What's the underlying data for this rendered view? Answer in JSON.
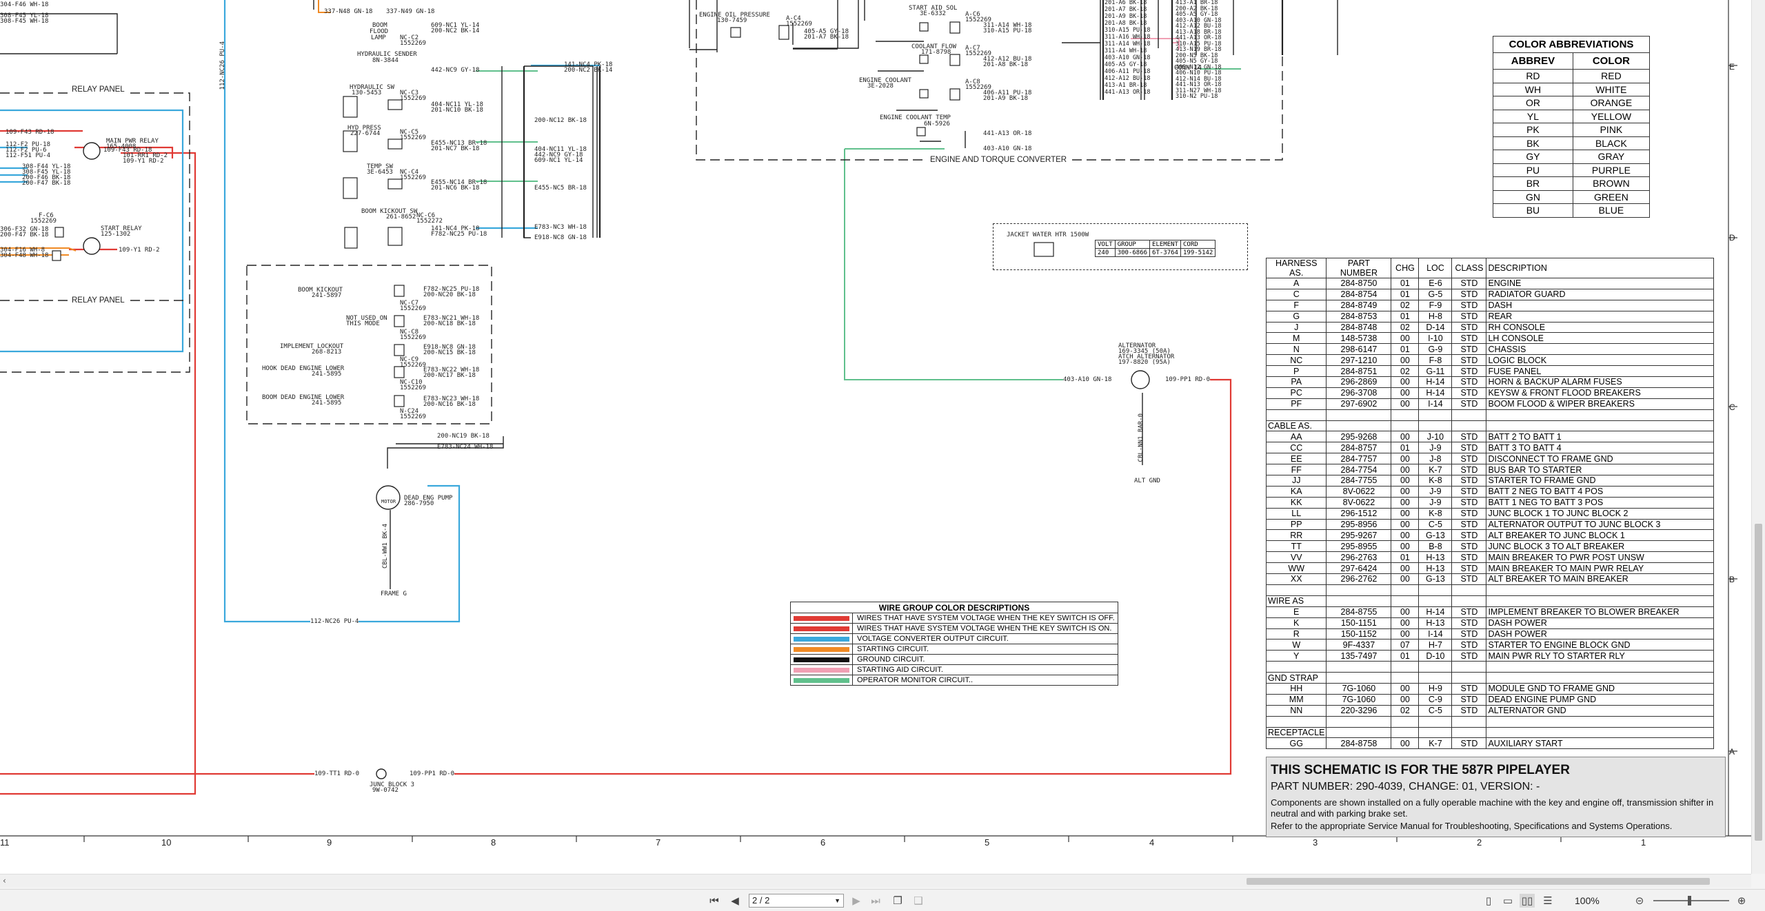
{
  "color_abbreviations": {
    "title": "COLOR ABBREVIATIONS",
    "headers": [
      "ABBREV",
      "COLOR"
    ],
    "rows": [
      [
        "RD",
        "RED"
      ],
      [
        "WH",
        "WHITE"
      ],
      [
        "OR",
        "ORANGE"
      ],
      [
        "YL",
        "YELLOW"
      ],
      [
        "PK",
        "PINK"
      ],
      [
        "BK",
        "BLACK"
      ],
      [
        "GY",
        "GRAY"
      ],
      [
        "PU",
        "PURPLE"
      ],
      [
        "BR",
        "BROWN"
      ],
      [
        "GN",
        "GREEN"
      ],
      [
        "BU",
        "BLUE"
      ]
    ]
  },
  "harness_table": {
    "headers": [
      "HARNESS AS.",
      "PART NUMBER",
      "CHG",
      "LOC",
      "CLASS",
      "DESCRIPTION"
    ],
    "sections": [
      {
        "title": "",
        "rows": [
          [
            "A",
            "284-8750",
            "01",
            "E-6",
            "STD",
            "ENGINE"
          ],
          [
            "C",
            "284-8754",
            "01",
            "G-5",
            "STD",
            "RADIATOR GUARD"
          ],
          [
            "F",
            "284-8749",
            "02",
            "F-9",
            "STD",
            "DASH"
          ],
          [
            "G",
            "284-8753",
            "01",
            "H-8",
            "STD",
            "REAR"
          ],
          [
            "J",
            "284-8748",
            "02",
            "D-14",
            "STD",
            "RH CONSOLE"
          ],
          [
            "M",
            "148-5738",
            "00",
            "I-10",
            "STD",
            "LH CONSOLE"
          ],
          [
            "N",
            "298-6147",
            "01",
            "G-9",
            "STD",
            "CHASSIS"
          ],
          [
            "NC",
            "297-1210",
            "00",
            "F-8",
            "STD",
            "LOGIC BLOCK"
          ],
          [
            "P",
            "284-8751",
            "02",
            "G-11",
            "STD",
            "FUSE PANEL"
          ],
          [
            "PA",
            "296-2869",
            "00",
            "H-14",
            "STD",
            "HORN & BACKUP ALARM FUSES"
          ],
          [
            "PC",
            "296-3708",
            "00",
            "H-14",
            "STD",
            "KEYSW & FRONT FLOOD BREAKERS"
          ],
          [
            "PF",
            "297-6902",
            "00",
            "I-14",
            "STD",
            "BOOM FLOOD & WIPER BREAKERS"
          ]
        ]
      },
      {
        "title": "CABLE AS.",
        "rows": [
          [
            "AA",
            "295-9268",
            "00",
            "J-10",
            "STD",
            "BATT 2 TO BATT 1"
          ],
          [
            "CC",
            "284-8757",
            "01",
            "J-9",
            "STD",
            "BATT 3 TO BATT 4"
          ],
          [
            "EE",
            "284-7757",
            "00",
            "J-8",
            "STD",
            "DISCONNECT TO FRAME GND"
          ],
          [
            "FF",
            "284-7754",
            "00",
            "K-7",
            "STD",
            "BUS BAR TO STARTER"
          ],
          [
            "JJ",
            "284-7755",
            "00",
            "K-8",
            "STD",
            "STARTER TO FRAME GND"
          ],
          [
            "KA",
            "8V-0622",
            "00",
            "J-9",
            "STD",
            "BATT 2 NEG TO BATT 4 POS"
          ],
          [
            "KK",
            "8V-0622",
            "00",
            "J-9",
            "STD",
            "BATT 1 NEG TO BATT 3 POS"
          ],
          [
            "LL",
            "296-1512",
            "00",
            "K-8",
            "STD",
            "JUNC BLOCK 1 TO JUNC BLOCK 2"
          ],
          [
            "PP",
            "295-8956",
            "00",
            "C-5",
            "STD",
            "ALTERNATOR OUTPUT TO JUNC BLOCK 3"
          ],
          [
            "RR",
            "295-9267",
            "00",
            "G-13",
            "STD",
            "ALT BREAKER TO JUNC BLOCK 1"
          ],
          [
            "TT",
            "295-8955",
            "00",
            "B-8",
            "STD",
            "JUNC BLOCK 3 TO ALT BREAKER"
          ],
          [
            "VV",
            "296-2763",
            "01",
            "H-13",
            "STD",
            "MAIN BREAKER TO PWR POST UNSW"
          ],
          [
            "WW",
            "297-6424",
            "00",
            "H-13",
            "STD",
            "MAIN BREAKER TO MAIN PWR RELAY"
          ],
          [
            "XX",
            "296-2762",
            "00",
            "G-13",
            "STD",
            "ALT BREAKER TO MAIN BREAKER"
          ]
        ]
      },
      {
        "title": "WIRE AS",
        "rows": [
          [
            "E",
            "284-8755",
            "00",
            "H-14",
            "STD",
            "IMPLEMENT BREAKER TO BLOWER BREAKER"
          ],
          [
            "K",
            "150-1151",
            "00",
            "H-13",
            "STD",
            "DASH POWER"
          ],
          [
            "R",
            "150-1152",
            "00",
            "I-14",
            "STD",
            "DASH POWER"
          ],
          [
            "W",
            "9F-4337",
            "07",
            "H-7",
            "STD",
            "STARTER TO ENGINE BLOCK GND"
          ],
          [
            "Y",
            "135-7497",
            "01",
            "D-10",
            "STD",
            "MAIN PWR RLY TO STARTER RLY"
          ]
        ]
      },
      {
        "title": "GND STRAP",
        "rows": [
          [
            "HH",
            "7G-1060",
            "00",
            "H-9",
            "STD",
            "MODULE GND TO FRAME GND"
          ],
          [
            "MM",
            "7G-1060",
            "00",
            "C-9",
            "STD",
            "DEAD ENGINE PUMP GND"
          ],
          [
            "NN",
            "220-3296",
            "02",
            "C-5",
            "STD",
            "ALTERNATOR GND"
          ]
        ]
      },
      {
        "title": "RECEPTACLE",
        "rows": [
          [
            "GG",
            "284-8758",
            "00",
            "K-7",
            "STD",
            "AUXILIARY START"
          ]
        ]
      }
    ]
  },
  "wire_group": {
    "title": "WIRE GROUP COLOR DESCRIPTIONS",
    "rows": [
      {
        "color": "#e03a34",
        "text": "WIRES THAT HAVE SYSTEM VOLTAGE WHEN THE KEY SWITCH IS OFF."
      },
      {
        "color": "#e03a34",
        "text": "WIRES THAT HAVE SYSTEM VOLTAGE WHEN THE KEY SWITCH IS ON."
      },
      {
        "color": "#3aa8dc",
        "text": "VOLTAGE CONVERTER OUTPUT CIRCUIT."
      },
      {
        "color": "#f08a24",
        "text": "STARTING CIRCUIT."
      },
      {
        "color": "#111111",
        "text": "GROUND CIRCUIT."
      },
      {
        "color": "#f0a0b4",
        "text": "STARTING AID CIRCUIT."
      },
      {
        "color": "#60c08c",
        "text": "OPERATOR MONITOR CIRCUIT.."
      }
    ]
  },
  "info": {
    "title": "THIS SCHEMATIC IS FOR THE 587R PIPELAYER",
    "part": "PART NUMBER: 290-4039, CHANGE: 01, VERSION: -",
    "note1": "Components are shown installed on a fully operable machine with the key and engine off, transmission shifter in neutral and with parking brake set.",
    "note2": "Refer to the appropriate Service Manual for Troubleshooting, Specifications and Systems Operations."
  },
  "jacket_water": {
    "label": "JACKET WATER HTR 1500W",
    "headers": [
      "VOLT",
      "GROUP",
      "ELEMENT",
      "CORD"
    ],
    "row": [
      "240",
      "300-6866",
      "6T-3764",
      "199-5142"
    ]
  },
  "labels": {
    "relay_panel": "RELAY PANEL",
    "relay_panel_2": "RELAY PANEL",
    "engine_torque": "ENGINE AND TORQUE CONVERTER",
    "conn14": "CONN 14",
    "main_pwr_relay": "MAIN PWR RELAY",
    "main_pwr_relay_pn": "165-4008",
    "start_relay": "START RELAY",
    "start_relay_pn": "125-1302",
    "fc6": "F-C6",
    "fc6_pn": "1552269",
    "boom_flood": "BOOM",
    "boom_flood2": "FLOOD",
    "boom_flood3": "LAMP",
    "nc_c2": "NC-C2",
    "nc_c2_pn": "1552269",
    "hyd_sender": "HYDRAULIC SENDER",
    "hyd_sender_pn": "8N-3844",
    "hyd_sw": "HYDRAULIC SW",
    "hyd_sw_pn": "130-5453",
    "nc_c3": "NC-C3",
    "nc_c3_pn": "1552269",
    "hyd_press": "HYD PRESS",
    "hyd_press_pn": "227-6744",
    "nc_c5": "NC-C5",
    "nc_c5_pn": "1552269",
    "temp_sw": "TEMP SW",
    "temp_sw_pn": "3E-6453",
    "nc_c4": "NC-C4",
    "nc_c4_pn": "1552269",
    "boom_kickout": "BOOM KICKOUT SW",
    "boom_kickout_pn": "261-8652",
    "nc_c6": "NC-C6",
    "nc_c6_pn": "1552272",
    "boom_kickout2": "BOOM KICKOUT",
    "boom_kickout2_pn": "241-5897",
    "not_used": "NOT USED ON",
    "not_used2": "THIS MODE",
    "implement_lockout": "IMPLEMENT LOCKOUT",
    "implement_lockout_pn": "268-8213",
    "hook_dead": "HOOK DEAD ENGINE LOWER",
    "hook_dead_pn": "241-5895",
    "boom_dead": "BOOM DEAD ENGINE LOWER",
    "boom_dead_pn": "241-5895",
    "nc_c7": "NC-C7",
    "nc_c8": "NC-C8",
    "nc_c9": "NC-C9",
    "nc_c10": "NC-C10",
    "n_c24": "N-C24",
    "pn_1552269": "1552269",
    "dead_eng_pump": "DEAD ENG PUMP",
    "dead_eng_pump_pn": "286-7950",
    "motor": "MOTOR",
    "frame_g": "FRAME G",
    "junc_block3": "JUNC BLOCK 3",
    "junc_block3_pn": "9W-0742",
    "engine_oil": "ENGINE OIL PRESSURE",
    "engine_oil_pn": "130-7459",
    "start_aid": "START AID SOL",
    "start_aid_pn": "3E-6332",
    "coolant_flow": "COOLANT FLOW",
    "coolant_flow_pn": "171-8798",
    "engine_coolant": "ENGINE COOLANT",
    "engine_coolant_pn": "3E-2028",
    "engine_coolant_temp": "ENGINE COOLANT TEMP",
    "engine_coolant_temp_pn": "6N-5926",
    "alternator": "ALTERNATOR",
    "alternator_pn1": "169-3345 (50A)",
    "alternator_pn2": "ATCH ALTERNATOR",
    "alternator_pn3": "197-8820 (95A)",
    "alt_gnd": "ALT GND",
    "a_c4": "A-C4",
    "a_c5": "A-C5",
    "a_c6": "A-C6",
    "a_c7": "A-C7",
    "a_c8": "A-C8",
    "pn_1552269b": "1552269"
  },
  "wire_labels": {
    "w1": "337-N48 GN-18",
    "w2": "337-N49 GN-18",
    "w3": "609-NC1 YL-14",
    "w4": "200-NC2 BK-14",
    "w5": "442-NC9 GY-18",
    "w6": "404-NC11 YL-18",
    "w7": "201-NC10 BK-18",
    "w8": "E455-NC13 BR-18",
    "w9": "201-NC7 BK-18",
    "w10": "E455-NC14 BR-18",
    "w11": "201-NC6 BK-18",
    "w12": "141-NC4 PK-18",
    "w13": "F782-NC25 PU-18",
    "w14": "F782-NC25 PU-18",
    "w15": "200-NC20 BK-18",
    "w16": "E783-NC21 WH-18",
    "w17": "200-NC18 BK-18",
    "w18": "E918-NC8 GN-18",
    "w19": "200-NC15 BK-18",
    "w20": "E783-NC22 WH-18",
    "w21": "200-NC17 BK-18",
    "w22": "E783-NC23 WH-18",
    "w23": "200-NC16 BK-18",
    "w24": "200-NC19 BK-18",
    "w25": "E783-NC24 WH-18",
    "w26": "112-NC26 PU-4",
    "w27": "109-TT1 RD-0",
    "w28": "109-PP1 RD-0",
    "w29": "403-A10 GN-18",
    "w30": "109-PP1 RD-0",
    "w31": "441-A13 OR-18",
    "w32": "403-A10 GN-18",
    "w33": "311-A14 WH-18",
    "w34": "310-A15 PU-18",
    "w35": "412-A12 BU-18",
    "w36": "201-A8 BK-18",
    "w37": "406-A11 PU-18",
    "w38": "201-A9 BK-18",
    "w39": "405-A5 GY-18",
    "w40": "201-A7 BK-18",
    "w41": "109-F43 RD-18",
    "w42": "112-F2 PU-18",
    "w43": "112-F2 PU-6",
    "w44": "112-F51 PU-4",
    "w45": "308-F44 YL-18",
    "w46": "308-F45 YL-18",
    "w47": "200-F46 BK-18",
    "w48": "200-F47 BK-18",
    "w49": "109-F43 RD-18",
    "w50": "101-RR1 RD-2",
    "w51": "109-Y1 RD-2",
    "w52": "306-F32 GN-18",
    "w53": "200-F47 BK-18",
    "w54": "304-F16 WH-8",
    "w55": "304-F48 WH-18",
    "w56": "109-Y1 RD-2",
    "w57": "304-F46 WH-18",
    "w58": "308-F45 YL-18",
    "w59": "308-F45 WH-18",
    "w60": "CBL-WW1 BK-4",
    "w61": "CBL-NN1 BAR-0",
    "w62": "141-NC4 PK-18",
    "w63": "200-NC2 BK-14",
    "w64": "E455-NC5 BR-18",
    "w65": "E783-NC3 WH-18",
    "w66": "E918-NC8 GN-18",
    "w67": "200-NC12 BK-18",
    "w68": "609-NC1 YL-14",
    "w69": "442-NC9 GY-18",
    "w70": "404-NC11 YL-18",
    "w71": "112-NC26 PU-4"
  },
  "conn14_wires": [
    "413-A1 BR-18",
    "200-A2 BK-18",
    "405-A5 GY-18",
    "403-A10 GN-18",
    "412-A12 BU-18",
    "413-A18 BR-18",
    "441-A13 OR-18",
    "310-A15 PU-18",
    "413-N19 BR-18",
    "200-N5 BK-18",
    "405-N5 GY-18",
    "403-N12 GN-18",
    "406-N10 PU-18",
    "412-N14 BU-18",
    "441-N13 OR-18",
    "311-N27 WH-18",
    "310-N2 PU-18"
  ],
  "left_block_wires": [
    "201-A6 BK-18",
    "201-A7 BK-18",
    "201-A9 BK-18",
    "201-A8 BK-18",
    "310-A15 PU-18",
    "311-A16 WH-18",
    "311-A14 WH-18",
    "311-A4 WH-18",
    "403-A10 GN-18",
    "405-A5 GY-18",
    "406-A11 PU-18",
    "412-A12 BU-18",
    "413-A1 BR-18",
    "441-A13 OR-18"
  ],
  "ruler_numbers": [
    "11",
    "10",
    "9",
    "8",
    "7",
    "6",
    "5",
    "4",
    "3",
    "2",
    "1"
  ],
  "ruler_letters": [
    "E",
    "D",
    "C",
    "B",
    "A"
  ],
  "toolbar": {
    "page": "2 / 2",
    "zoom": "100%"
  },
  "colors": {
    "red": "#e03a34",
    "blue": "#3aa8dc",
    "green": "#60c08c",
    "orange": "#f08a24",
    "pink": "#f0a0b4",
    "black": "#111111"
  }
}
